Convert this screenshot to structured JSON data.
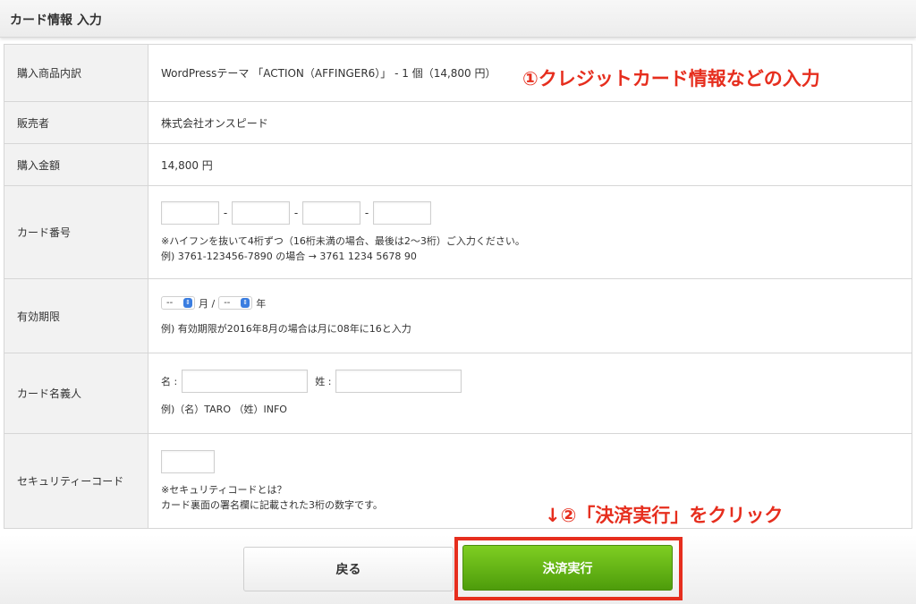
{
  "header": {
    "title": "カード情報 入力"
  },
  "rows": {
    "product": {
      "label": "購入商品内訳",
      "value": "WordPressテーマ 「ACTION（AFFINGER6）」 - 1 個（14,800 円）"
    },
    "seller": {
      "label": "販売者",
      "value": "株式会社オンスピード"
    },
    "amount": {
      "label": "購入金額",
      "value": "14,800 円"
    },
    "card_number": {
      "label": "カード番号",
      "separator": "-",
      "note1": "※ハイフンを抜いて4桁ずつ（16桁未満の場合、最後は2〜3桁）ご入力ください。",
      "note2": "例) 3761-123456-7890 の場合 → 3761 1234 5678 90"
    },
    "expiry": {
      "label": "有効期限",
      "month_value": "--",
      "month_unit": "月 /",
      "year_value": "--",
      "year_unit": "年",
      "note": "例) 有効期限が2016年8月の場合は月に08年に16と入力"
    },
    "holder": {
      "label": "カード名義人",
      "first_label": "名 :",
      "last_label": "姓 :",
      "note": "例)（名）TARO （姓）INFO"
    },
    "security": {
      "label": "セキュリティーコード",
      "note1": "※セキュリティコードとは？",
      "note2": "カード裏面の署名欄に記載された3桁の数字です。"
    }
  },
  "annotations": {
    "step1": "①クレジットカード情報などの入力",
    "step2": "↓②「決済実行」をクリック",
    "accent_color": "#e62e1e"
  },
  "buttons": {
    "back": "戻る",
    "pay": "決済実行"
  }
}
